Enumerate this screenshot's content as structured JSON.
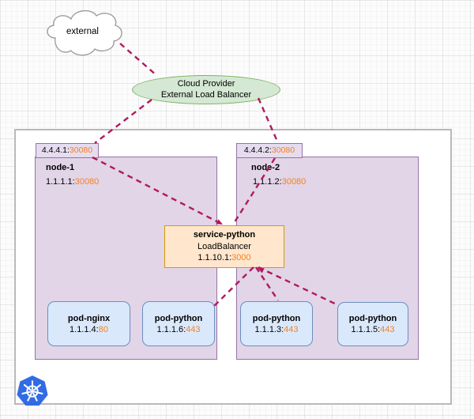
{
  "external": {
    "label": "external"
  },
  "load_balancer": {
    "line1": "Cloud Provider",
    "line2": "External Load Balancer"
  },
  "nodes": [
    {
      "name": "node-1",
      "external_endpoint": {
        "ip": "4.4.4.1:",
        "port": "30080"
      },
      "internal_endpoint": {
        "ip": "1.1.1.1:",
        "port": "30080"
      },
      "pods": [
        {
          "name": "pod-nginx",
          "ip": "1.1.1.4:",
          "port": "80"
        },
        {
          "name": "pod-python",
          "ip": "1.1.1.6:",
          "port": "443"
        }
      ]
    },
    {
      "name": "node-2",
      "external_endpoint": {
        "ip": "4.4.4.2:",
        "port": "30080"
      },
      "internal_endpoint": {
        "ip": "1.1.1.2:",
        "port": "30080"
      },
      "pods": [
        {
          "name": "pod-python",
          "ip": "1.1.1.3:",
          "port": "443"
        },
        {
          "name": "pod-python",
          "ip": "1.1.1.5:",
          "port": "443"
        }
      ]
    }
  ],
  "service": {
    "name": "service-python",
    "type": "LoadBalancer",
    "ip": "1.1.10.1:",
    "port": "3000"
  },
  "icons": {
    "kubernetes": "kubernetes-logo"
  },
  "colors": {
    "node_fill": "#e1d5e7",
    "node_stroke": "#9673a6",
    "pod_fill": "#dae8fc",
    "pod_stroke": "#6c8ebf",
    "service_fill": "#ffe6cc",
    "service_stroke": "#d79b00",
    "lb_fill": "#d5e8d4",
    "lb_stroke": "#82b366",
    "edge": "#b1195d",
    "port_text": "#f5821f",
    "kubernetes_blue": "#326ce5"
  },
  "edges": [
    {
      "from": "external",
      "to": "cloud-provider-external-load-balancer"
    },
    {
      "from": "cloud-provider-external-load-balancer",
      "to": "node-1-nodeport-4.4.4.1:30080"
    },
    {
      "from": "cloud-provider-external-load-balancer",
      "to": "node-2-nodeport-4.4.4.2:30080"
    },
    {
      "from": "node-1-nodeport-4.4.4.1:30080",
      "to": "service-python"
    },
    {
      "from": "node-2-nodeport-4.4.4.2:30080",
      "to": "service-python"
    },
    {
      "from": "service-python",
      "to": "pod-python-1.1.1.6:443"
    },
    {
      "from": "service-python",
      "to": "pod-python-1.1.1.3:443"
    },
    {
      "from": "service-python",
      "to": "pod-python-1.1.1.5:443"
    }
  ]
}
